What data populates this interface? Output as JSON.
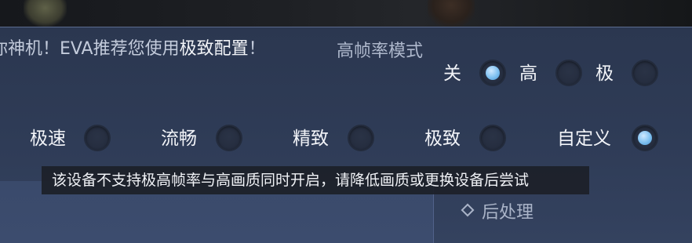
{
  "recommendation": {
    "prefix": "你神机！EVA推荐您使用",
    "highlight": "极致配置",
    "suffix": "！"
  },
  "high_frame_rate": {
    "label": "高帧率模式",
    "options": [
      {
        "label": "关",
        "selected": true
      },
      {
        "label": "高",
        "selected": false
      },
      {
        "label": "极",
        "selected": false
      }
    ]
  },
  "quality": {
    "options": [
      {
        "label": "极速",
        "selected": false
      },
      {
        "label": "流畅",
        "selected": false
      },
      {
        "label": "精致",
        "selected": false
      },
      {
        "label": "极致",
        "selected": false
      },
      {
        "label": "自定义",
        "selected": true
      }
    ]
  },
  "tooltip": "该设备不支持极高帧率与高画质同时开启，请降低画质或更换设备后尝试",
  "sections": {
    "post_processing": "后处理"
  },
  "colors": {
    "panel": "#2f3c57",
    "radio_selected": "#7ec0f0",
    "tooltip_bg": "#1c2028"
  }
}
